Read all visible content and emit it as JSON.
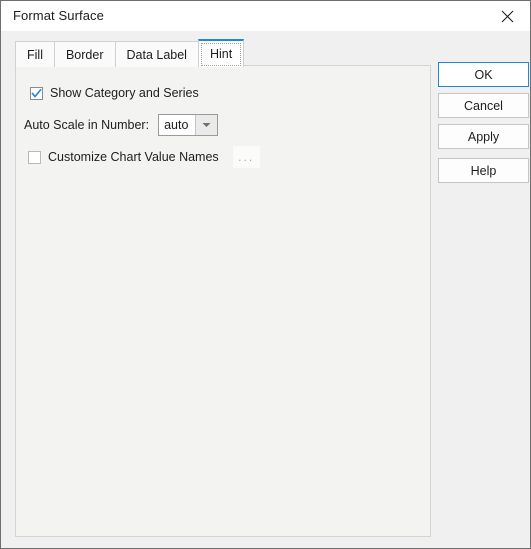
{
  "window": {
    "title": "Format Surface",
    "close_icon": "close-icon"
  },
  "tabs": [
    {
      "label": "Fill",
      "selected": false
    },
    {
      "label": "Border",
      "selected": false
    },
    {
      "label": "Data Label",
      "selected": false
    },
    {
      "label": "Hint",
      "selected": true
    }
  ],
  "hint_panel": {
    "show_category_and_series": {
      "label": "Show Category and Series",
      "checked": true
    },
    "auto_scale": {
      "label": "Auto Scale in Number:",
      "value": "auto",
      "options": [
        "auto"
      ],
      "arrow_icon": "chevron-down-icon"
    },
    "customize_chart_value_names": {
      "label": "Customize Chart Value Names",
      "checked": false
    },
    "browse_button": {
      "label": "...",
      "enabled": false
    }
  },
  "buttons": {
    "ok": "OK",
    "cancel": "Cancel",
    "apply": "Apply",
    "help": "Help"
  },
  "colors": {
    "accent": "#1a8ad4",
    "window_bg": "#f0f0f0",
    "panel_bg": "#f3f4f2",
    "titlebar_bg": "#ffffff",
    "border": "#6e6e6e"
  }
}
